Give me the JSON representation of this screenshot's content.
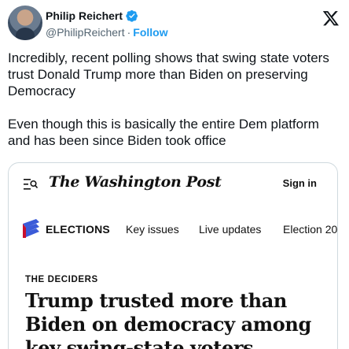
{
  "tweet": {
    "author_name": "Philip Reichert",
    "handle": "@PhilipReichert",
    "separator": "·",
    "follow_label": "Follow",
    "text": "Incredibly, recent polling shows that swing state voters trust Donald Trump more than Biden on preserving Democracy\n\nEven though this is basically the entire Dem platform and has been since Biden took office",
    "icons": {
      "verified": "verified-badge-icon",
      "logo": "x-logo-icon"
    },
    "colors": {
      "verified": "#1d9bf0",
      "follow": "#1d9bf0"
    }
  },
  "card": {
    "publication": "The Washington Post",
    "signin_label": "Sign in",
    "section_label": "ELECTIONS",
    "nav_items": [
      "Key issues",
      "Live updates",
      "Election 20"
    ],
    "kicker": "THE DECIDERS",
    "headline": "Trump trusted more than Biden on democracy among key swing-state voters",
    "icons": {
      "menu": "search-menu-icon",
      "section": "ballot-icon"
    }
  }
}
